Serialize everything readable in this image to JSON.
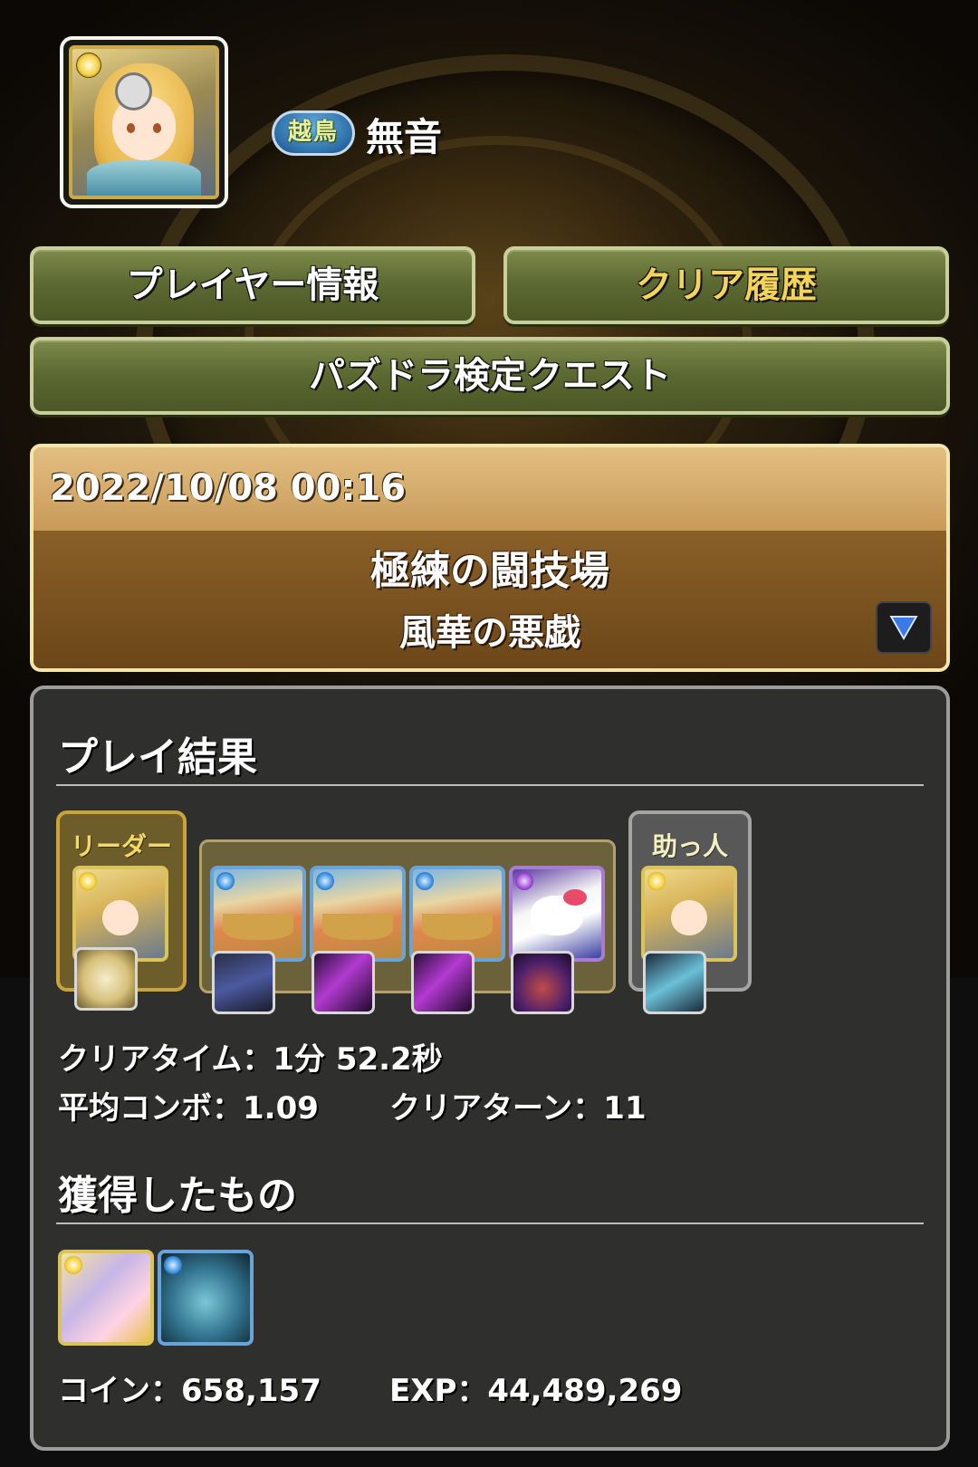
{
  "player": {
    "rank_badge": "越鳥",
    "name": "無音"
  },
  "nav": {
    "player_info": "プレイヤー情報",
    "clear_history": "クリア履歴",
    "quest": "パズドラ検定クエスト"
  },
  "record": {
    "datetime": "2022/10/08 00:16",
    "dungeon": "極練の闘技場",
    "floor": "風華の悪戯"
  },
  "results": {
    "title": "プレイ結果",
    "leader_label": "リーダー",
    "helper_label": "助っ人",
    "team": [
      {
        "role": "leader",
        "attribute": "light",
        "icon": "blonde-girl-icon",
        "assist_icon": "medal-icon"
      },
      {
        "role": "sub",
        "attribute": "water",
        "icon": "ship-monster-icon",
        "assist_icon": "card-icon"
      },
      {
        "role": "sub",
        "attribute": "water",
        "icon": "ship-monster-icon",
        "assist_icon": "sword-icon"
      },
      {
        "role": "sub",
        "attribute": "water",
        "icon": "ship-monster-icon",
        "assist_icon": "sword-icon"
      },
      {
        "role": "sub",
        "attribute": "dark",
        "icon": "hello-kitty-icon",
        "assist_icon": "witch-icon"
      },
      {
        "role": "helper",
        "attribute": "light",
        "icon": "blonde-girl-icon",
        "assist_icon": "spear-icon"
      }
    ],
    "clear_time": "クリアタイム：1分 52.2秒",
    "avg_combo": "平均コンボ：1.09",
    "clear_turn": "クリアターン：11"
  },
  "drops": {
    "title": "獲得したもの",
    "items": [
      {
        "icon": "evolution-material-icon",
        "attribute": "light"
      },
      {
        "icon": "blue-monster-icon",
        "attribute": "water"
      }
    ],
    "coin": "コイン：658,157",
    "exp": "EXP：44,489,269"
  },
  "colors": {
    "button_green": "#5d6a32",
    "history_text": "#f3d35a",
    "record_bar": "#c89a58",
    "panel_bg": "#2f302e"
  }
}
